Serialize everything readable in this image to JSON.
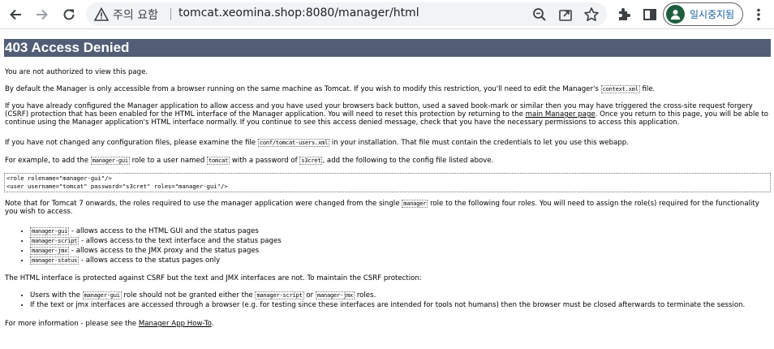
{
  "browser": {
    "security_status": "주의 요함",
    "url": "tomcat.xeomina.shop:8080/manager/html",
    "profile_label": "일시중지됨",
    "icons": [
      "back-icon",
      "forward-icon",
      "reload-icon",
      "warning-icon",
      "zoom-icon",
      "share-icon",
      "bookmark-star-icon",
      "extensions-icon",
      "side-panel-icon",
      "avatar-icon",
      "menu-icon"
    ]
  },
  "page": {
    "title": "403 Access Denied",
    "p1": "You are not authorized to view this page.",
    "p2": {
      "before": "By default the Manager is only accessible from a browser running on the same machine as Tomcat. If you wish to modify this restriction, you'll need to edit the Manager's",
      "code": "context.xml",
      "after": "file."
    },
    "p3": {
      "before": "If you have already configured the Manager application to allow access and you have used your browsers back button, used a saved book-mark or similar then you may have triggered the cross-site request forgery (CSRF) protection that has been enabled for the HTML interface of the Manager application. You will need to reset this protection by returning to the",
      "link": "main Manager page",
      "after": ". Once you return to this page, you will be able to continue using the Manager application's HTML interface normally. If you continue to see this access denied message, check that you have the necessary permissions to access this application."
    },
    "p4": {
      "before": "If you have not changed any configuration files, please examine the file",
      "code": "conf/tomcat-users.xml",
      "after": "in your installation. That file must contain the credentials to let you use this webapp."
    },
    "p5": {
      "t1": "For example, to add the",
      "c1": "manager-gui",
      "t2": "role to a user named",
      "c2": "tomcat",
      "t3": "with a password of",
      "c3": "s3cret",
      "t4": ", add the following to the config file listed above."
    },
    "pre": "<role rolename=\"manager-gui\"/>\n<user username=\"tomcat\" password=\"s3cret\" roles=\"manager-gui\"/>",
    "p6": {
      "before": "Note that for Tomcat 7 onwards, the roles required to use the manager application were changed from the single",
      "code": "manager",
      "after": "role to the following four roles. You will need to assign the role(s) required for the functionality you wish to access."
    },
    "roles": [
      {
        "code": "manager-gui",
        "text": "- allows access to the HTML GUI and the status pages"
      },
      {
        "code": "manager-script",
        "text": "- allows access to the text interface and the status pages"
      },
      {
        "code": "manager-jmx",
        "text": "- allows access to the JMX proxy and the status pages"
      },
      {
        "code": "manager-status",
        "text": "- allows access to the status pages only"
      }
    ],
    "p7": "The HTML interface is protected against CSRF but the text and JMX interfaces are not. To maintain the CSRF protection:",
    "csrf1": {
      "t1": "Users with the",
      "c1": "manager-gui",
      "t2": "role should not be granted either the",
      "c2": "manager-script",
      "t3": "or",
      "c3": "manager-jmx",
      "t4": "roles."
    },
    "csrf2": "If the text or jmx interfaces are accessed through a browser (e.g. for testing since these interfaces are intended for tools not humans) then the browser must be closed afterwards to terminate the session.",
    "p8": {
      "before": "For more information - please see the",
      "link": "Manager App How-To",
      "after": "."
    }
  }
}
